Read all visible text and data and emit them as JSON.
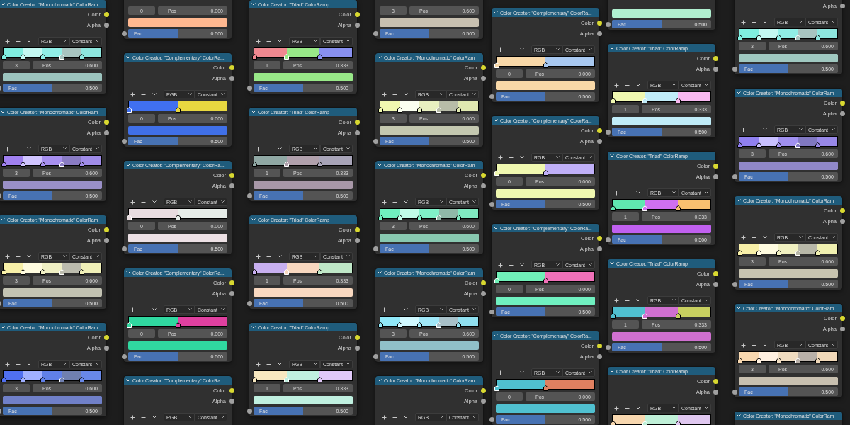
{
  "columns": [
    {
      "nodes": [
        {
          "title": "Color Creator: \"Monochromatic\" ColorRam",
          "outputs": [
            {
              "label": "Color",
              "color": "#d8d830"
            },
            {
              "label": "Alpha",
              "color": "#a0a0a0"
            }
          ],
          "toolbar": {
            "mode": "RGB",
            "interpolation": "Constant"
          },
          "ramp": [
            {
              "level": 0,
              "color": "#80eee0",
              "selected": false
            },
            {
              "level": 0.2,
              "color": "#c4f8f2",
              "selected": false
            },
            {
              "level": 0.4,
              "color": "#90eee6",
              "selected": false
            },
            {
              "level": 0.6,
              "color": "#a8c4c0",
              "selected": true
            },
            {
              "level": 0.8,
              "color": "#8ee6de",
              "selected": false
            }
          ],
          "stop": {
            "index": "3",
            "label": "Pos",
            "value": "0.600"
          },
          "swatch": {
            "color": "#9cc4be"
          },
          "fac": {
            "label": "Fac",
            "value": "0.500",
            "level": 0.5
          }
        },
        {
          "title": "Color Creator: \"Monochromatic\" ColorRam",
          "outputs": [
            {
              "label": "Color",
              "color": "#d8d830"
            },
            {
              "label": "Alpha",
              "color": "#a0a0a0"
            }
          ],
          "toolbar": {
            "mode": "RGB",
            "interpolation": "Constant"
          },
          "ramp": [
            {
              "level": 0,
              "color": "#a080f0",
              "selected": false
            },
            {
              "level": 0.2,
              "color": "#d0c4ff",
              "selected": false
            },
            {
              "level": 0.4,
              "color": "#a890f0",
              "selected": false
            },
            {
              "level": 0.6,
              "color": "#8a7cc4",
              "selected": true
            },
            {
              "level": 0.8,
              "color": "#a08ce8",
              "selected": false
            }
          ],
          "stop": {
            "index": "3",
            "label": "Pos",
            "value": "0.600"
          },
          "swatch": {
            "color": "#9a90c8"
          },
          "fac": {
            "label": "Fac",
            "value": "0.500",
            "level": 0.5
          }
        },
        {
          "title": "Color Creator: \"Monochromatic\" ColorRam",
          "outputs": [
            {
              "label": "Color",
              "color": "#d8d830"
            },
            {
              "label": "Alpha",
              "color": "#a0a0a0"
            }
          ],
          "toolbar": {
            "mode": "RGB",
            "interpolation": "Constant"
          },
          "ramp": [
            {
              "level": 0,
              "color": "#f8f0a8",
              "selected": false
            },
            {
              "level": 0.2,
              "color": "#fffce0",
              "selected": false
            },
            {
              "level": 0.4,
              "color": "#f0f0c4",
              "selected": false
            },
            {
              "level": 0.6,
              "color": "#bcbcae",
              "selected": true
            },
            {
              "level": 0.8,
              "color": "#f0f0b8",
              "selected": false
            }
          ],
          "stop": {
            "index": "3",
            "label": "Pos",
            "value": "0.600"
          },
          "swatch": {
            "color": "#c2c2b2"
          },
          "fac": {
            "label": "Fac",
            "value": "0.500",
            "level": 0.5
          }
        },
        {
          "title": "Color Creator: \"Monochromatic\" ColorRam",
          "outputs": [
            {
              "label": "Color",
              "color": "#d8d830"
            },
            {
              "label": "Alpha",
              "color": "#a0a0a0"
            }
          ],
          "toolbar": {
            "mode": "RGB",
            "interpolation": "Constant"
          },
          "ramp": [
            {
              "level": 0,
              "color": "#5070f0",
              "selected": false
            },
            {
              "level": 0.2,
              "color": "#a0b0ff",
              "selected": false
            },
            {
              "level": 0.4,
              "color": "#6080e8",
              "selected": false
            },
            {
              "level": 0.6,
              "color": "#7080b0",
              "selected": true
            },
            {
              "level": 0.8,
              "color": "#6888e8",
              "selected": false
            }
          ],
          "stop": {
            "index": "3",
            "label": "Pos",
            "value": "0.600"
          },
          "swatch": {
            "color": "#7080c8"
          },
          "fac": {
            "label": "Fac",
            "value": "0.500",
            "level": 0.5
          }
        }
      ]
    },
    {
      "nodes": [
        {
          "stop": {
            "index": "0",
            "label": "Pos",
            "value": "0.000"
          },
          "swatch": {
            "color": "#ffb890"
          },
          "fac": {
            "label": "Fac",
            "value": "0.500",
            "level": 0.5
          }
        },
        {
          "title": "Color Creator: \"Complementary\" ColorRa...",
          "outputs": [
            {
              "label": "Color",
              "color": "#d8d830"
            },
            {
              "label": "Alpha",
              "color": "#a0a0a0"
            }
          ],
          "toolbar": {
            "mode": "RGB",
            "interpolation": "Constant"
          },
          "ramp": [
            {
              "level": 0,
              "color": "#4070f0",
              "selected": true
            },
            {
              "level": 0.5,
              "color": "#e8d840",
              "selected": false
            }
          ],
          "stop": {
            "index": "0",
            "label": "Pos",
            "value": "0.000"
          },
          "swatch": {
            "color": "#4070e8"
          },
          "fac": {
            "label": "Fac",
            "value": "0.500",
            "level": 0.5
          }
        },
        {
          "title": "Color Creator: \"Complementary\" ColorRa...",
          "outputs": [
            {
              "label": "Color",
              "color": "#d8d830"
            },
            {
              "label": "Alpha",
              "color": "#a0a0a0"
            }
          ],
          "toolbar": {
            "mode": "RGB",
            "interpolation": "Constant"
          },
          "ramp": [
            {
              "level": 0,
              "color": "#e8dce0",
              "selected": true
            },
            {
              "level": 0.5,
              "color": "#e6ece8",
              "selected": false
            }
          ],
          "stop": {
            "index": "0",
            "label": "Pos",
            "value": "0.000"
          },
          "swatch": {
            "color": "#ece0e4"
          },
          "fac": {
            "label": "Fac",
            "value": "0.500",
            "level": 0.5
          }
        },
        {
          "title": "Color Creator: \"Complementary\" ColorRa...",
          "outputs": [
            {
              "label": "Color",
              "color": "#d8d830"
            },
            {
              "label": "Alpha",
              "color": "#a0a0a0"
            }
          ],
          "toolbar": {
            "mode": "RGB",
            "interpolation": "Constant"
          },
          "ramp": [
            {
              "level": 0,
              "color": "#30d8a0",
              "selected": true
            },
            {
              "level": 0.5,
              "color": "#e040a0",
              "selected": false
            }
          ],
          "stop": {
            "index": "0",
            "label": "Pos",
            "value": "0.000"
          },
          "swatch": {
            "color": "#30d8a0"
          },
          "fac": {
            "label": "Fac",
            "value": "0.500",
            "level": 0.5
          }
        },
        {
          "title": "Color Creator: \"Complementary\" ColorRa...",
          "outputs": [
            {
              "label": "Color",
              "color": "#d8d830"
            },
            {
              "label": "Alpha",
              "color": "#a0a0a0"
            }
          ],
          "toolbar": {
            "mode": "RGB",
            "interpolation": "Constant"
          }
        }
      ]
    },
    {
      "nodes": [
        {
          "title": "Color Creator: \"Triad\" ColorRamp",
          "outputs": [
            {
              "label": "Color",
              "color": "#d8d830"
            },
            {
              "label": "Alpha",
              "color": "#a0a0a0"
            }
          ],
          "toolbar": {
            "mode": "RGB",
            "interpolation": "Constant"
          },
          "ramp": [
            {
              "level": 0,
              "color": "#f08890",
              "selected": false
            },
            {
              "level": 0.333,
              "color": "#98e888",
              "selected": true
            },
            {
              "level": 0.667,
              "color": "#8890f0",
              "selected": false
            }
          ],
          "stop": {
            "index": "1",
            "label": "Pos",
            "value": "0.333"
          },
          "swatch": {
            "color": "#98e888"
          },
          "fac": {
            "label": "Fac",
            "value": "0.500",
            "level": 0.5
          }
        },
        {
          "title": "Color Creator: \"Triad\" ColorRamp",
          "outputs": [
            {
              "label": "Color",
              "color": "#d8d830"
            },
            {
              "label": "Alpha",
              "color": "#a0a0a0"
            }
          ],
          "toolbar": {
            "mode": "RGB",
            "interpolation": "Constant"
          },
          "ramp": [
            {
              "level": 0,
              "color": "#90a8a4",
              "selected": false
            },
            {
              "level": 0.333,
              "color": "#b0a0ac",
              "selected": true
            },
            {
              "level": 0.667,
              "color": "#a8a4b8",
              "selected": false
            }
          ],
          "stop": {
            "index": "1",
            "label": "Pos",
            "value": "0.333"
          },
          "swatch": {
            "color": "#a898a8"
          },
          "fac": {
            "label": "Fac",
            "value": "0.500",
            "level": 0.5
          }
        },
        {
          "title": "Color Creator: \"Triad\" ColorRamp",
          "outputs": [
            {
              "label": "Color",
              "color": "#d8d830"
            },
            {
              "label": "Alpha",
              "color": "#a0a0a0"
            }
          ],
          "toolbar": {
            "mode": "RGB",
            "interpolation": "Constant"
          },
          "ramp": [
            {
              "level": 0,
              "color": "#c8b0f0",
              "selected": false
            },
            {
              "level": 0.333,
              "color": "#f8d8c0",
              "selected": true
            },
            {
              "level": 0.667,
              "color": "#c0e8c8",
              "selected": false
            }
          ],
          "stop": {
            "index": "1",
            "label": "Pos",
            "value": "0.333"
          },
          "swatch": {
            "color": "#f8d8c0"
          },
          "fac": {
            "label": "Fac",
            "value": "0.500",
            "level": 0.5
          }
        },
        {
          "title": "Color Creator: \"Triad\" ColorRamp",
          "outputs": [
            {
              "label": "Color",
              "color": "#d8d830"
            },
            {
              "label": "Alpha",
              "color": "#a0a0a0"
            }
          ],
          "toolbar": {
            "mode": "RGB",
            "interpolation": "Constant"
          },
          "ramp": [
            {
              "level": 0,
              "color": "#f8e8c0",
              "selected": false
            },
            {
              "level": 0.333,
              "color": "#c0f0e0",
              "selected": true
            },
            {
              "level": 0.667,
              "color": "#e0c8f8",
              "selected": false
            }
          ],
          "stop": {
            "index": "1",
            "label": "Pos",
            "value": "0.333"
          },
          "swatch": {
            "color": "#c0f0e0"
          },
          "fac": {
            "label": "Fac",
            "value": "0.500",
            "level": 0.5
          }
        }
      ]
    },
    {
      "nodes": [
        {
          "stop": {
            "index": "3",
            "label": "Pos",
            "value": "0.600"
          },
          "swatch": {
            "color": "#c8c0b0"
          },
          "fac": {
            "label": "Fac",
            "value": "0.500",
            "level": 0.5
          }
        },
        {
          "title": "Color Creator: \"Monochromatic\" ColorRam",
          "outputs": [
            {
              "label": "Color",
              "color": "#d8d830"
            },
            {
              "label": "Alpha",
              "color": "#a0a0a0"
            }
          ],
          "toolbar": {
            "mode": "RGB",
            "interpolation": "Constant"
          },
          "ramp": [
            {
              "level": 0,
              "color": "#f0f8b0",
              "selected": false
            },
            {
              "level": 0.2,
              "color": "#fafff0",
              "selected": false
            },
            {
              "level": 0.4,
              "color": "#e8f0c0",
              "selected": false
            },
            {
              "level": 0.6,
              "color": "#b8bca8",
              "selected": true
            },
            {
              "level": 0.8,
              "color": "#e0e8b0",
              "selected": false
            }
          ],
          "stop": {
            "index": "3",
            "label": "Pos",
            "value": "0.600"
          },
          "swatch": {
            "color": "#c4c8b0"
          },
          "fac": {
            "label": "Fac",
            "value": "0.500",
            "level": 0.5
          }
        },
        {
          "title": "Color Creator: \"Monochromatic\" ColorRam",
          "outputs": [
            {
              "label": "Color",
              "color": "#d8d830"
            },
            {
              "label": "Alpha",
              "color": "#a0a0a0"
            }
          ],
          "toolbar": {
            "mode": "RGB",
            "interpolation": "Constant"
          },
          "ramp": [
            {
              "level": 0,
              "color": "#70f0c0",
              "selected": false
            },
            {
              "level": 0.2,
              "color": "#c0fce8",
              "selected": false
            },
            {
              "level": 0.4,
              "color": "#80f0c8",
              "selected": false
            },
            {
              "level": 0.6,
              "color": "#90b8a8",
              "selected": true
            },
            {
              "level": 0.8,
              "color": "#80e8c0",
              "selected": false
            }
          ],
          "stop": {
            "index": "3",
            "label": "Pos",
            "value": "0.600"
          },
          "swatch": {
            "color": "#88c8b0"
          },
          "fac": {
            "label": "Fac",
            "value": "0.500",
            "level": 0.5
          }
        },
        {
          "title": "Color Creator: \"Monochromatic\" ColorRam",
          "outputs": [
            {
              "label": "Color",
              "color": "#d8d830"
            },
            {
              "label": "Alpha",
              "color": "#a0a0a0"
            }
          ],
          "toolbar": {
            "mode": "RGB",
            "interpolation": "Constant"
          },
          "ramp": [
            {
              "level": 0,
              "color": "#90e8f8",
              "selected": false
            },
            {
              "level": 0.2,
              "color": "#d0f8ff",
              "selected": false
            },
            {
              "level": 0.4,
              "color": "#a0e8f8",
              "selected": false
            },
            {
              "level": 0.6,
              "color": "#a8c0c8",
              "selected": true
            },
            {
              "level": 0.8,
              "color": "#90e0f0",
              "selected": false
            }
          ],
          "stop": {
            "index": "3",
            "label": "Pos",
            "value": "0.600"
          },
          "swatch": {
            "color": "#90c0c8"
          },
          "fac": {
            "label": "Fac",
            "value": "0.500",
            "level": 0.5
          }
        },
        {
          "title": "Color Creator: \"Monochromatic\" ColorRam",
          "outputs": [
            {
              "label": "Color",
              "color": "#d8d830"
            },
            {
              "label": "Alpha",
              "color": "#a0a0a0"
            }
          ],
          "toolbar": {
            "mode": "RGB",
            "interpolation": "Constant"
          }
        }
      ]
    },
    {
      "nodes": [
        {
          "title": "Color Creator: \"Complementary\" ColorRa...",
          "outputs": [
            {
              "label": "Color",
              "color": "#d8d830"
            },
            {
              "label": "Alpha",
              "color": "#a0a0a0"
            }
          ],
          "toolbar": {
            "mode": "RGB",
            "interpolation": "Constant"
          },
          "ramp": [
            {
              "level": 0,
              "color": "#f8d8a8",
              "selected": true
            },
            {
              "level": 0.5,
              "color": "#a8c8f0",
              "selected": false
            }
          ],
          "stop": {
            "index": "0",
            "label": "Pos",
            "value": "0.000"
          },
          "swatch": {
            "color": "#f8d8a8"
          },
          "fac": {
            "label": "Fac",
            "value": "0.500",
            "level": 0.5
          }
        },
        {
          "title": "Color Creator: \"Complementary\" ColorRa...",
          "outputs": [
            {
              "label": "Color",
              "color": "#d8d830"
            },
            {
              "label": "Alpha",
              "color": "#a0a0a0"
            }
          ],
          "toolbar": {
            "mode": "RGB",
            "interpolation": "Constant"
          },
          "ramp": [
            {
              "level": 0,
              "color": "#f0f8b0",
              "selected": true
            },
            {
              "level": 0.5,
              "color": "#c0b0f8",
              "selected": false
            }
          ],
          "stop": {
            "index": "0",
            "label": "Pos",
            "value": "0.000"
          },
          "swatch": {
            "color": "#f0f8b0"
          },
          "fac": {
            "label": "Fac",
            "value": "0.500",
            "level": 0.5
          }
        },
        {
          "title": "Color Creator: \"Complementary\" ColorRa...",
          "outputs": [
            {
              "label": "Color",
              "color": "#d8d830"
            },
            {
              "label": "Alpha",
              "color": "#a0a0a0"
            }
          ],
          "toolbar": {
            "mode": "RGB",
            "interpolation": "Constant"
          },
          "ramp": [
            {
              "level": 0,
              "color": "#70f0b8",
              "selected": true
            },
            {
              "level": 0.5,
              "color": "#f070b8",
              "selected": false
            }
          ],
          "stop": {
            "index": "0",
            "label": "Pos",
            "value": "0.000"
          },
          "swatch": {
            "color": "#70f0c0"
          },
          "fac": {
            "label": "Fac",
            "value": "0.500",
            "level": 0.5
          }
        },
        {
          "title": "Color Creator: \"Complementary\" ColorRa...",
          "outputs": [
            {
              "label": "Color",
              "color": "#d8d830"
            },
            {
              "label": "Alpha",
              "color": "#a0a0a0"
            }
          ],
          "toolbar": {
            "mode": "RGB",
            "interpolation": "Constant"
          },
          "ramp": [
            {
              "level": 0,
              "color": "#50c0d0",
              "selected": true
            },
            {
              "level": 0.5,
              "color": "#e08060",
              "selected": false
            }
          ],
          "stop": {
            "index": "0",
            "label": "Pos",
            "value": "0.000"
          },
          "swatch": {
            "color": "#50c0d0"
          },
          "fac": {
            "label": "Fac",
            "value": "0.500",
            "level": 0.5
          }
        }
      ]
    },
    {
      "nodes": [
        {
          "swatch": {
            "color": "#b0f0d0"
          },
          "fac": {
            "label": "Fac",
            "value": "0.500",
            "level": 0.5
          }
        },
        {
          "title": "Color Creator: \"Triad\" ColorRamp",
          "outputs": [
            {
              "label": "Color",
              "color": "#d8d830"
            },
            {
              "label": "Alpha",
              "color": "#a0a0a0"
            }
          ],
          "toolbar": {
            "mode": "RGB",
            "interpolation": "Constant"
          },
          "ramp": [
            {
              "level": 0,
              "color": "#f0f8b0",
              "selected": false
            },
            {
              "level": 0.333,
              "color": "#c0ecf8",
              "selected": true
            },
            {
              "level": 0.667,
              "color": "#f8b8f0",
              "selected": false
            }
          ],
          "stop": {
            "index": "1",
            "label": "Pos",
            "value": "0.333"
          },
          "swatch": {
            "color": "#c0ecf8"
          },
          "fac": {
            "label": "Fac",
            "value": "0.500",
            "level": 0.5
          }
        },
        {
          "title": "Color Creator: \"Triad\" ColorRamp",
          "outputs": [
            {
              "label": "Color",
              "color": "#d8d830"
            },
            {
              "label": "Alpha",
              "color": "#a0a0a0"
            }
          ],
          "toolbar": {
            "mode": "RGB",
            "interpolation": "Constant"
          },
          "ramp": [
            {
              "level": 0,
              "color": "#60e8b0",
              "selected": false
            },
            {
              "level": 0.333,
              "color": "#d070f0",
              "selected": true
            },
            {
              "level": 0.667,
              "color": "#f8c070",
              "selected": false
            }
          ],
          "stop": {
            "index": "1",
            "label": "Pos",
            "value": "0.333"
          },
          "swatch": {
            "color": "#c060f0"
          },
          "fac": {
            "label": "Fac",
            "value": "0.500",
            "level": 0.5
          }
        },
        {
          "title": "Color Creator: \"Triad\" ColorRamp",
          "outputs": [
            {
              "label": "Color",
              "color": "#d8d830"
            },
            {
              "label": "Alpha",
              "color": "#a0a0a0"
            }
          ],
          "toolbar": {
            "mode": "RGB",
            "interpolation": "Constant"
          },
          "ramp": [
            {
              "level": 0,
              "color": "#50c0d0",
              "selected": false
            },
            {
              "level": 0.333,
              "color": "#d070d0",
              "selected": true
            },
            {
              "level": 0.667,
              "color": "#c8d060",
              "selected": false
            }
          ],
          "stop": {
            "index": "1",
            "label": "Pos",
            "value": "0.333"
          },
          "swatch": {
            "color": "#d070d0"
          },
          "fac": {
            "label": "Fac",
            "value": "0.500",
            "level": 0.5
          }
        },
        {
          "title": "Color Creator: \"Triad\" ColorRamp",
          "outputs": [
            {
              "label": "Color",
              "color": "#d8d830"
            },
            {
              "label": "Alpha",
              "color": "#a0a0a0"
            }
          ],
          "toolbar": {
            "mode": "RGB",
            "interpolation": "Constant"
          },
          "ramp": [
            {
              "level": 0,
              "color": "#f8d8b0",
              "selected": false
            },
            {
              "level": 0.333,
              "color": "#c0f0d8",
              "selected": true
            },
            {
              "level": 0.667,
              "color": "#e0c8f0",
              "selected": false
            }
          ]
        }
      ]
    },
    {
      "nodes": [
        {
          "outputs": [
            {
              "label": "Alpha",
              "color": "#a0a0a0"
            }
          ],
          "toolbar": {
            "mode": "RGB",
            "interpolation": "Constant"
          },
          "ramp": [
            {
              "level": 0,
              "color": "#80eee0",
              "selected": false
            },
            {
              "level": 0.2,
              "color": "#c4f8f2",
              "selected": false
            },
            {
              "level": 0.4,
              "color": "#90eee6",
              "selected": false
            },
            {
              "level": 0.6,
              "color": "#a8c4c0",
              "selected": true
            },
            {
              "level": 0.8,
              "color": "#8ee6de",
              "selected": false
            }
          ],
          "stop": {
            "index": "3",
            "label": "Pos",
            "value": "0.600"
          },
          "swatch": {
            "color": "#a0c8c0"
          },
          "fac": {
            "label": "Fac",
            "value": "0.500",
            "level": 0.5
          }
        },
        {
          "title": "Color Creator: \"Monochromatic\" ColorRam",
          "outputs": [
            {
              "label": "Color",
              "color": "#d8d830"
            },
            {
              "label": "Alpha",
              "color": "#a0a0a0"
            }
          ],
          "toolbar": {
            "mode": "RGB",
            "interpolation": "Constant"
          },
          "ramp": [
            {
              "level": 0,
              "color": "#9080f0",
              "selected": false
            },
            {
              "level": 0.2,
              "color": "#c8c0ff",
              "selected": false
            },
            {
              "level": 0.4,
              "color": "#a090f0",
              "selected": false
            },
            {
              "level": 0.6,
              "color": "#8078c0",
              "selected": true
            },
            {
              "level": 0.8,
              "color": "#9888e8",
              "selected": false
            }
          ],
          "stop": {
            "index": "3",
            "label": "Pos",
            "value": "0.600"
          },
          "swatch": {
            "color": "#9088c8"
          },
          "fac": {
            "label": "Fac",
            "value": "0.500",
            "level": 0.5
          }
        },
        {
          "title": "Color Creator: \"Monochromatic\" ColorRam",
          "outputs": [
            {
              "label": "Color",
              "color": "#d8d830"
            },
            {
              "label": "Alpha",
              "color": "#a0a0a0"
            }
          ],
          "toolbar": {
            "mode": "RGB",
            "interpolation": "Constant"
          },
          "ramp": [
            {
              "level": 0,
              "color": "#f8f0a8",
              "selected": false
            },
            {
              "level": 0.2,
              "color": "#fffce0",
              "selected": false
            },
            {
              "level": 0.4,
              "color": "#f0f0c0",
              "selected": false
            },
            {
              "level": 0.6,
              "color": "#b8b8a8",
              "selected": true
            },
            {
              "level": 0.8,
              "color": "#f0f0b0",
              "selected": false
            }
          ],
          "stop": {
            "index": "3",
            "label": "Pos",
            "value": "0.600"
          },
          "swatch": {
            "color": "#c8c4b0"
          },
          "fac": {
            "label": "Fac",
            "value": "0.500",
            "level": 0.5
          }
        },
        {
          "title": "Color Creator: \"Monochromatic\" ColorRam",
          "outputs": [
            {
              "label": "Color",
              "color": "#d8d830"
            },
            {
              "label": "Alpha",
              "color": "#a0a0a0"
            }
          ],
          "toolbar": {
            "mode": "RGB",
            "interpolation": "Constant"
          },
          "ramp": [
            {
              "level": 0,
              "color": "#f8d8b0",
              "selected": false
            },
            {
              "level": 0.2,
              "color": "#fff0e0",
              "selected": false
            },
            {
              "level": 0.4,
              "color": "#f0dcc0",
              "selected": false
            },
            {
              "level": 0.6,
              "color": "#b8b0a8",
              "selected": true
            },
            {
              "level": 0.8,
              "color": "#f0d8b8",
              "selected": false
            }
          ],
          "stop": {
            "index": "3",
            "label": "Pos",
            "value": "0.600"
          },
          "swatch": {
            "color": "#c8c0b0"
          },
          "fac": {
            "label": "Fac",
            "value": "0.500",
            "level": 0.5
          }
        },
        {
          "title": "Color Creator: \"Monochromatic\" ColorRam"
        }
      ]
    }
  ]
}
